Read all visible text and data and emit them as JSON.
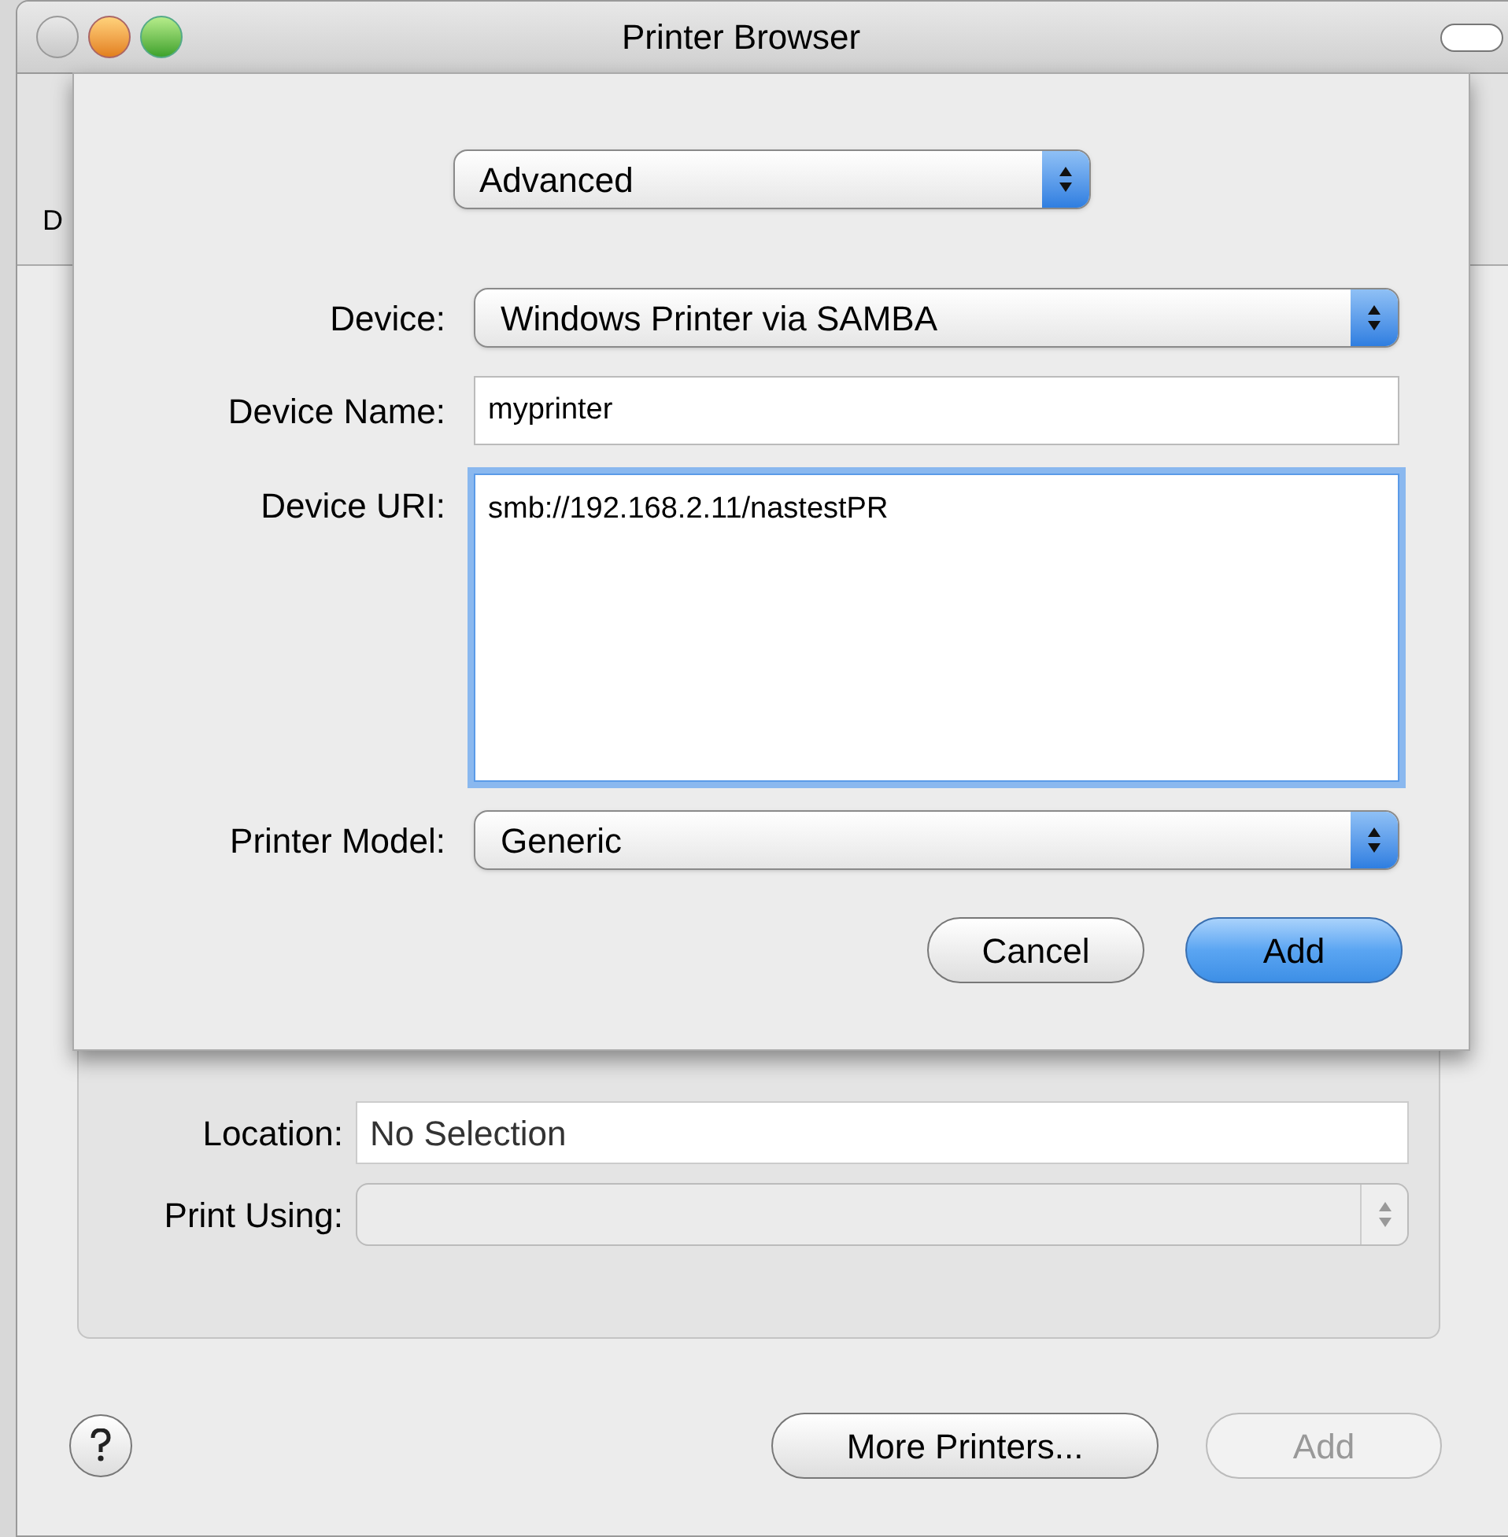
{
  "window": {
    "title": "Printer Browser"
  },
  "background": {
    "toolbar_label": "D",
    "location": {
      "label": "Location:",
      "value": "No Selection"
    },
    "print_using": {
      "label": "Print Using:",
      "disabled": true
    },
    "buttons": [
      {
        "label": "More Printers...",
        "disabled": false
      },
      {
        "label": "Add",
        "disabled": true
      }
    ]
  },
  "sheet": {
    "mode": "Advanced",
    "fields": [
      {
        "kind": "popup",
        "label": "Device:",
        "value": "Windows Printer via SAMBA"
      },
      {
        "kind": "text",
        "label": "Device Name:",
        "value": "myprinter",
        "focused": false
      },
      {
        "kind": "area",
        "label": "Device URI:",
        "value": "smb://192.168.2.11/nastestPR",
        "focused": true
      },
      {
        "kind": "popup",
        "label": "Printer Model:",
        "value": "Generic"
      }
    ],
    "buttons": [
      {
        "label": "Cancel",
        "default": false
      },
      {
        "label": "Add",
        "default": true
      }
    ]
  }
}
